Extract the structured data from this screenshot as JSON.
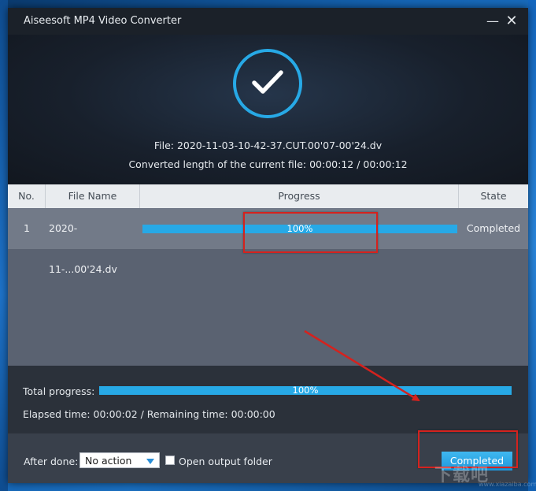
{
  "window": {
    "title": "Aiseesoft MP4 Video Converter",
    "minimize_glyph": "—",
    "close_glyph": "✕"
  },
  "hero": {
    "file_line": "File: 2020-11-03-10-42-37.CUT.00'07-00'24.dv",
    "converted_line": "Converted length of the current file: 00:00:12 / 00:00:12",
    "check_icon": "check-circle-icon"
  },
  "table": {
    "headers": {
      "no": "No.",
      "file_name": "File Name",
      "progress": "Progress",
      "state": "State"
    },
    "rows": [
      {
        "no": "1",
        "file_name": "2020-11-...00'24.dv",
        "progress_label": "100%",
        "progress_fraction": 1.0,
        "state": "Completed"
      }
    ]
  },
  "total": {
    "label": "Total progress:",
    "progress_label": "100%",
    "progress_fraction": 1.0,
    "elapsed_line": "Elapsed time: 00:00:02 / Remaining time: 00:00:00"
  },
  "footer": {
    "after_done_label": "After done:",
    "after_done_value": "No action",
    "open_folder_label": "Open output folder",
    "open_folder_checked": false,
    "completed_button": "Completed"
  },
  "watermark": {
    "text": "下载吧",
    "url": "www.xiazaiba.com"
  },
  "colors": {
    "accent": "#27a9e6",
    "annotation": "#d5221e",
    "title_bar": "#1b2129"
  }
}
